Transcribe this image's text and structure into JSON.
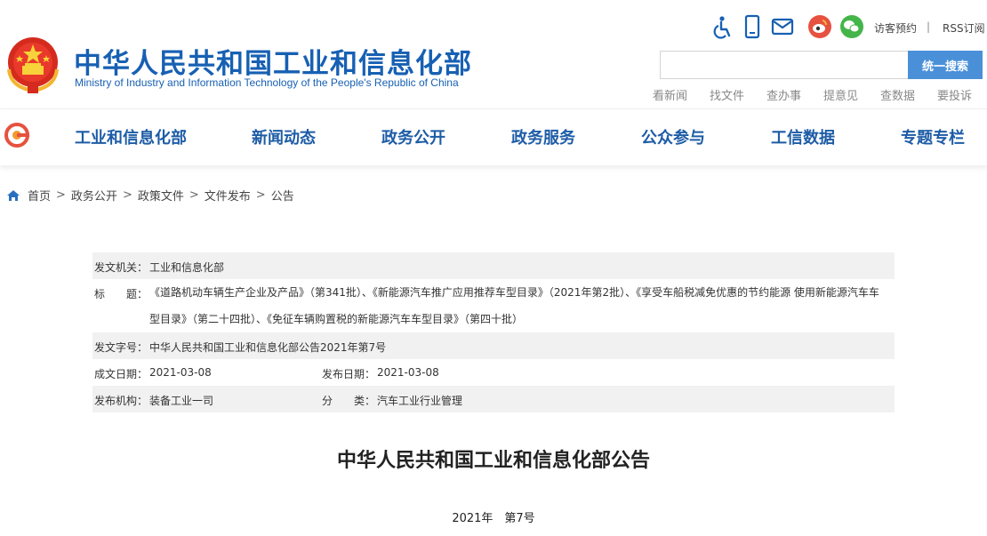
{
  "header": {
    "title": "中华人民共和国工业和信息化部",
    "subtitle": "Ministry of Industry and Information Technology of the People's Republic of China"
  },
  "toolbar": {
    "visitor_label": "访客预约",
    "separator": "|",
    "rss_label": "RSS订阅",
    "icons": [
      "accessibility-icon",
      "mobile-icon",
      "mail-icon",
      "weibo-icon",
      "wechat-icon"
    ]
  },
  "search": {
    "placeholder": "",
    "button_label": "统一搜索"
  },
  "quick_links": [
    "看新闻",
    "找文件",
    "查办事",
    "提意见",
    "查数据",
    "要投诉"
  ],
  "nav": {
    "items": [
      "工业和信息化部",
      "新闻动态",
      "政务公开",
      "政务服务",
      "公众参与",
      "工信数据",
      "专题专栏"
    ]
  },
  "breadcrumb": {
    "items": [
      "首页",
      "政务公开",
      "政策文件",
      "文件发布",
      "公告"
    ],
    "separator": ">"
  },
  "info": {
    "issuer_label": "发文机关：",
    "issuer": "工业和信息化部",
    "title_label": "标　　题：",
    "title": "《道路机动车辆生产企业及产品》（第341批）、《新能源汽车推广应用推荐车型目录》（2021年第2批）、《享受车船税减免优惠的节约能源 使用新能源汽车车型目录》（第二十四批）、《免征车辆购置税的新能源汽车车型目录》（第四十批）",
    "doc_no_label": "发文字号：",
    "doc_no": "中华人民共和国工业和信息化部公告2021年第7号",
    "created_label": "成文日期：",
    "created": "2021-03-08",
    "published_label": "发布日期：",
    "published": "2021-03-08",
    "org_label": "发布机构：",
    "org": "装备工业一司",
    "category_label": "分　　类：",
    "category": "汽车工业行业管理"
  },
  "document": {
    "heading": "中华人民共和国工业和信息化部公告",
    "number": "2021年　第7号"
  },
  "colors": {
    "brand_blue": "#1760b3",
    "nav_blue": "#1d5ca6",
    "search_button": "#4a90d9",
    "weibo_red": "#e6523f",
    "wechat_green": "#44b549",
    "row_shade": "#f1f1f1"
  }
}
